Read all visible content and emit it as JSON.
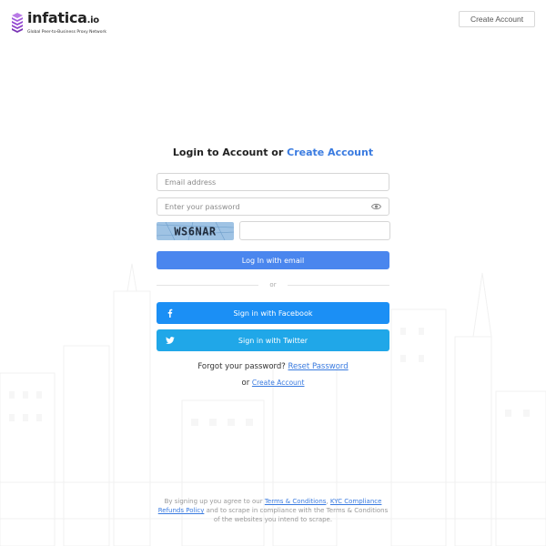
{
  "header": {
    "brand_name": "infatica",
    "brand_suffix": ".io",
    "tagline": "Global Peer-to-Business Proxy Network",
    "create_account_label": "Create Account"
  },
  "form": {
    "title_prefix": "Login to Account or",
    "title_link": "Create Account",
    "email_placeholder": "Email address",
    "email_value": "",
    "password_placeholder": "Enter your password",
    "password_value": "",
    "captcha_text": "WS6NAR",
    "captcha_value": "",
    "login_label": "Log In with email",
    "divider_text": "or",
    "facebook_label": "Sign in with Facebook",
    "twitter_label": "Sign in with Twitter",
    "forgot_text": "Forgot your password?",
    "reset_label": "Reset Password",
    "or_text": "or",
    "create_account_link": "Create Account"
  },
  "legal": {
    "part1": "By signing up you agree to our",
    "terms_link": "Terms & Conditions",
    "comma": ",",
    "kyc_link": "KYC Compliance",
    "refunds_link": "Refunds Policy",
    "part2": "and to scrape in compliance with the Terms & Conditions of the websites you intend to scrape."
  },
  "icons": {
    "logo": "stacked-layers-icon",
    "password_toggle": "eye-icon",
    "facebook": "facebook-icon",
    "twitter": "twitter-icon"
  },
  "colors": {
    "brand_purple": "#8e44c9",
    "link_blue": "#3a7be0",
    "login_button": "#4a86ee",
    "facebook_button": "#1b8ff5",
    "twitter_button": "#20a7e8"
  }
}
